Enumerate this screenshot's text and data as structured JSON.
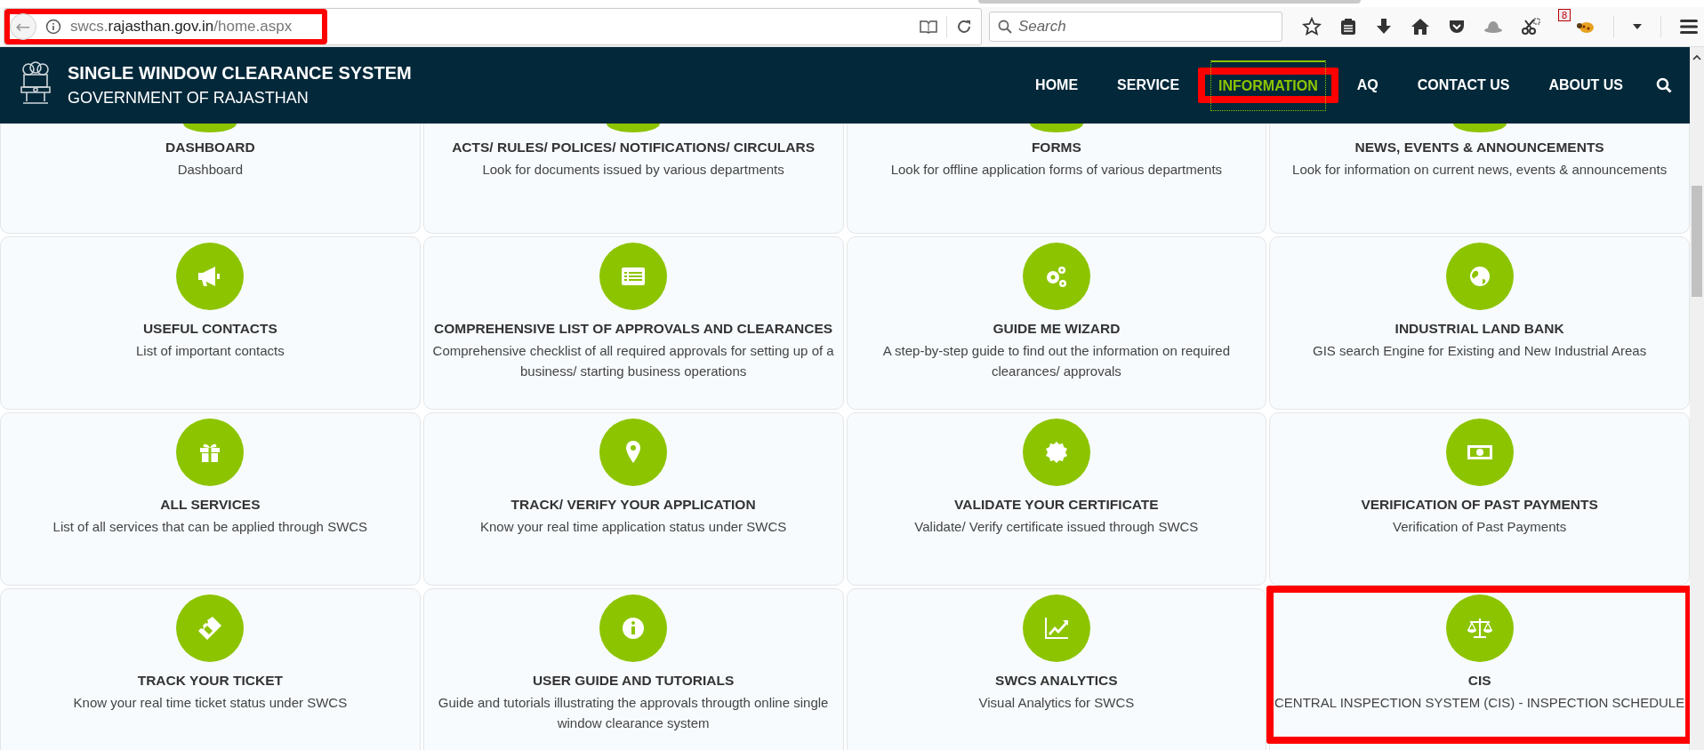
{
  "browser": {
    "back_label": "←",
    "url_highlighted": true,
    "url_parts": [
      {
        "text": "swcs.",
        "kind": "muted"
      },
      {
        "text": "rajasthan.gov.in",
        "kind": "domain"
      },
      {
        "text": "/home.aspx",
        "kind": "muted"
      }
    ],
    "search": {
      "placeholder": "Search"
    },
    "notification_count": "8"
  },
  "header": {
    "title": "SINGLE WINDOW CLEARANCE SYSTEM",
    "subtitle": "GOVERNMENT OF RAJASTHAN",
    "nav": [
      {
        "label": "HOME",
        "selected": false,
        "highlighted": false
      },
      {
        "label": "SERVICE",
        "selected": false,
        "highlighted": false
      },
      {
        "label": "INFORMATION",
        "selected": true,
        "highlighted": true
      },
      {
        "label": "AQ",
        "selected": false,
        "highlighted": false
      },
      {
        "label": "CONTACT US",
        "selected": false,
        "highlighted": false
      },
      {
        "label": "ABOUT US",
        "selected": false,
        "highlighted": false
      }
    ]
  },
  "cards": [
    {
      "title": "DASHBOARD",
      "description": "Dashboard",
      "highlighted": false
    },
    {
      "title": "ACTS/ RULES/ POLICES/ NOTIFICATIONS/ CIRCULARS",
      "description": "Look for documents issued by various departments",
      "highlighted": false
    },
    {
      "title": "FORMS",
      "description": "Look for offline application forms of various departments",
      "highlighted": false
    },
    {
      "title": "NEWS, EVENTS & ANNOUNCEMENTS",
      "description": "Look for information on current news, events & announcements",
      "highlighted": false
    },
    {
      "title": "USEFUL CONTACTS",
      "description": "List of important contacts",
      "kind": "megaphone",
      "highlighted": false
    },
    {
      "title": "COMPREHENSIVE LIST OF APPROVALS AND CLEARANCES",
      "description": "Comprehensive checklist of all required approvals for setting up of a business/ starting business operations",
      "kind": "list",
      "highlighted": false
    },
    {
      "title": "GUIDE ME WIZARD",
      "description": "A step-by-step guide to find out the information on required clearances/ approvals",
      "kind": "gears",
      "highlighted": false
    },
    {
      "title": "INDUSTRIAL LAND BANK",
      "description": "GIS search Engine for Existing and New Industrial Areas",
      "kind": "globe",
      "highlighted": false
    },
    {
      "title": "ALL SERVICES",
      "description": "List of all services that can be applied through SWCS",
      "kind": "gift",
      "highlighted": false
    },
    {
      "title": "TRACK/ VERIFY YOUR APPLICATION",
      "description": "Know your real time application status under SWCS",
      "kind": "pin",
      "highlighted": false
    },
    {
      "title": "VALIDATE YOUR CERTIFICATE",
      "description": "Validate/ Verify certificate issued through SWCS",
      "kind": "seal",
      "highlighted": false
    },
    {
      "title": "VERIFICATION OF PAST PAYMENTS",
      "description": "Verification of Past Payments",
      "kind": "money",
      "highlighted": false
    },
    {
      "title": "TRACK YOUR TICKET",
      "description": "Know your real time ticket status under SWCS",
      "kind": "ticket",
      "highlighted": false
    },
    {
      "title": "USER GUIDE AND TUTORIALS",
      "description": "Guide and tutorials illustrating the approvals througth online single window clearance system",
      "kind": "info",
      "highlighted": false
    },
    {
      "title": "SWCS ANALYTICS",
      "description": "Visual Analytics for SWCS",
      "kind": "chart",
      "highlighted": false
    },
    {
      "title": "CIS",
      "description": "CENTRAL INSPECTION SYSTEM (CIS) - INSPECTION SCHEDULE",
      "kind": "scales",
      "highlighted": true
    }
  ]
}
